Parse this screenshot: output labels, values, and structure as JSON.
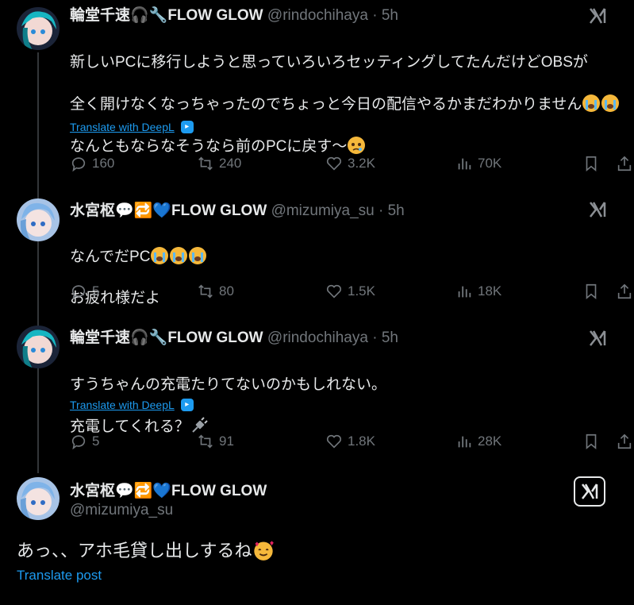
{
  "tweets": [
    {
      "name": "輪堂千速🎧🔧FLOW GLOW",
      "handle": "@rindochihaya",
      "dot": "·",
      "time": "5h",
      "text_lines": [
        "新しいPCに移行しようと思っていろいろセッティングしてたんだけどOBSが",
        "全く開けなくなっちゃったのでちょっと今日の配信やるかまだわかりません",
        "",
        "なんともならなそうなら前のPCに戻す～"
      ],
      "translate": "Translate with DeepL",
      "replies": "160",
      "reposts": "240",
      "likes": "3.2K",
      "views": "70K"
    },
    {
      "name": "水宮枢💬🔁💙FLOW GLOW",
      "handle": "@mizumiya_su",
      "dot": "·",
      "time": "5h",
      "text_lines": [
        "なんでだPC",
        "お疲れ様だよ"
      ],
      "replies": "5",
      "reposts": "80",
      "likes": "1.5K",
      "views": "18K"
    },
    {
      "name": "輪堂千速🎧🔧FLOW GLOW",
      "handle": "@rindochihaya",
      "dot": "·",
      "time": "5h",
      "text_lines": [
        "すうちゃんの充電たりてないのかもしれない。",
        "充電してくれる？"
      ],
      "translate": "Translate with DeepL",
      "replies": "5",
      "reposts": "91",
      "likes": "1.8K",
      "views": "28K"
    }
  ],
  "main_tweet": {
    "name": "水宮枢💬🔁💙FLOW GLOW",
    "handle": "@mizumiya_su",
    "text": "あっ、、アホ毛貸し出しするね",
    "translate": "Translate post"
  },
  "colors": {
    "background": "#000000",
    "text": "#e7e9ea",
    "muted": "#71767b",
    "link": "#1d9bf0"
  }
}
